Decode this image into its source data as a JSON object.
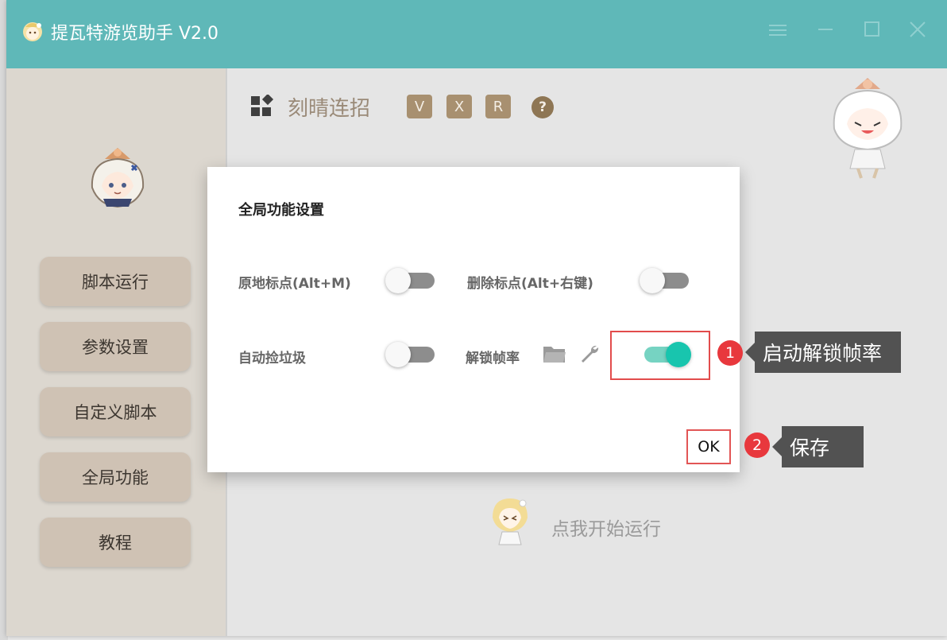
{
  "window": {
    "title": "提瓦特游览助手 V2.0",
    "controls": [
      "menu-icon",
      "minimize-icon",
      "maximize-icon",
      "close-icon"
    ]
  },
  "sidebar": {
    "items": [
      {
        "label": "脚本运行"
      },
      {
        "label": "参数设置"
      },
      {
        "label": "自定义脚本"
      },
      {
        "label": "全局功能"
      },
      {
        "label": "教程"
      }
    ]
  },
  "main": {
    "script_title": "刻晴连招",
    "tags": [
      "V",
      "X",
      "R"
    ],
    "help": "?",
    "run_label": "点我开始运行"
  },
  "dialog": {
    "title": "全局功能设置",
    "options": [
      {
        "label": "原地标点(Alt+M)",
        "enabled": false
      },
      {
        "label": "删除标点(Alt+右键)",
        "enabled": false
      },
      {
        "label": "自动捡垃圾",
        "enabled": false
      },
      {
        "label": "解锁帧率",
        "enabled": true
      }
    ],
    "ok_label": "OK"
  },
  "annotations": [
    {
      "step": "1",
      "text": "启动解锁帧率"
    },
    {
      "step": "2",
      "text": "保存"
    }
  ],
  "colors": {
    "titlebar": "#5fb8b8",
    "sidebar": "#dcd7cf",
    "sidebar_button": "#cfc2b4",
    "tag": "#a89070",
    "toggle_on": "#18c5ae",
    "highlight": "#e24c4c",
    "callout": "#525252"
  }
}
